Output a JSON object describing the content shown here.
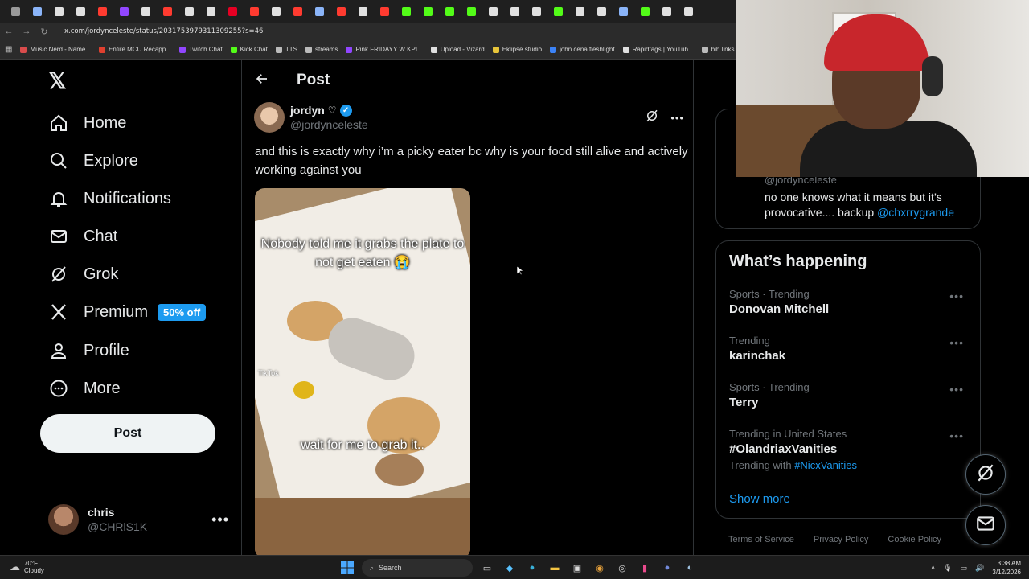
{
  "browser": {
    "url": "x.com/jordynceleste/status/2031753979311309255?s=46",
    "tabs": [
      "chrome",
      "mail",
      "x",
      "x",
      "youtube",
      "twitch",
      "tiktok",
      "youtube",
      "google",
      "grid",
      "pinterest",
      "youtube",
      "tiktok",
      "youtube",
      "mail",
      "youtube",
      "tiktok",
      "youtube",
      "kick",
      "kick",
      "kick",
      "kick",
      "tiktok",
      "tiktok",
      "x",
      "kick",
      "tiktok",
      "tiktok",
      "mail",
      "kick",
      "x",
      "x"
    ],
    "bookmarks": [
      "Music Nerd - Name...",
      "Entire MCU Recapp...",
      "Twitch Chat",
      "Kick Chat",
      "TTS",
      "streams",
      "Pink FRIDAYY W KPI...",
      "Upload - Vizard",
      "Eklipse studio",
      "john cena fleshlight",
      "Rapidtags | YouTub...",
      "bih links"
    ]
  },
  "nav": {
    "items": [
      {
        "label": "Home",
        "icon": "home-icon"
      },
      {
        "label": "Explore",
        "icon": "search-icon"
      },
      {
        "label": "Notifications",
        "icon": "bell-icon"
      },
      {
        "label": "Chat",
        "icon": "mail-icon"
      },
      {
        "label": "Grok",
        "icon": "grok-icon"
      },
      {
        "label": "Premium",
        "icon": "x-icon"
      },
      {
        "label": "Profile",
        "icon": "person-icon"
      },
      {
        "label": "More",
        "icon": "more-circle-icon"
      }
    ],
    "premium_badge": "50% off",
    "post_button": "Post",
    "account": {
      "name": "chris",
      "handle": "@CHRlS1K"
    }
  },
  "post_view": {
    "header_title": "Post",
    "author_name": "jordyn",
    "author_symbol": "♡",
    "author_handle": "@jordynceleste",
    "text": "and this is exactly why i’m a picky eater bc why is your food still alive and actively working against you",
    "media_caption_top": "Nobody told me it grabs the plate to not get eaten 😭",
    "media_caption_bottom": "wait for me to grab it..",
    "media_watermark": "TikTok"
  },
  "sidebar": {
    "preview_handle": "@jordynceleste",
    "preview_text": "no one knows what it means but it’s provocative.... backup",
    "preview_mention": "@chxrrygrande",
    "whats_happening_title": "What’s happening",
    "trends": [
      {
        "context": "Sports · Trending",
        "title": "Donovan Mitchell"
      },
      {
        "context": "Trending",
        "title": "karinchak"
      },
      {
        "context": "Sports · Trending",
        "title": "Terry"
      },
      {
        "context": "Trending in United States",
        "title": "#OlandriaxVanities",
        "with_label": "Trending with",
        "with_tag": "#NicxVanities"
      }
    ],
    "show_more": "Show more",
    "footer_links": [
      "Terms of Service",
      "Privacy Policy",
      "Cookie Policy"
    ]
  },
  "taskbar": {
    "weather_temp": "70°F",
    "weather_desc": "Cloudy",
    "search_label": "Search",
    "time": "3:38 AM",
    "date": "3/12/2026"
  },
  "colors": {
    "accent": "#1d9bf0",
    "background": "#000000",
    "text": "#e7e9ea",
    "muted": "#71767b"
  }
}
